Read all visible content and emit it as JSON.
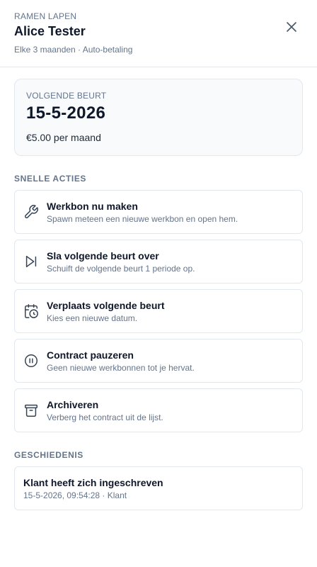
{
  "header": {
    "service": "RAMEN LAPEN",
    "customer": "Alice Tester",
    "subtitle": "Elke 3 maanden · Auto-betaling",
    "close_icon": "close-icon"
  },
  "next_service": {
    "label": "VOLGENDE BEURT",
    "date": "15-5-2026",
    "price": "€5.00 per maand"
  },
  "quick_actions": {
    "title": "SNELLE ACTIES",
    "items": [
      {
        "icon": "wrench-icon",
        "title": "Werkbon nu maken",
        "desc": "Spawn meteen een nieuwe werkbon en open hem."
      },
      {
        "icon": "skip-forward-icon",
        "title": "Sla volgende beurt over",
        "desc": "Schuift de volgende beurt 1 periode op."
      },
      {
        "icon": "calendar-clock-icon",
        "title": "Verplaats volgende beurt",
        "desc": "Kies een nieuwe datum."
      },
      {
        "icon": "pause-circle-icon",
        "title": "Contract pauzeren",
        "desc": "Geen nieuwe werkbonnen tot je hervat."
      },
      {
        "icon": "archive-icon",
        "title": "Archiveren",
        "desc": "Verberg het contract uit de lijst."
      }
    ]
  },
  "history": {
    "title": "GESCHIEDENIS",
    "items": [
      {
        "title": "Klant heeft zich ingeschreven",
        "meta": "15-5-2026, 09:54:28 · Klant"
      }
    ]
  },
  "colors": {
    "text": "#0f172a",
    "muted": "#64748b",
    "border": "#e2e8f0",
    "card_bg": "#f8fafc"
  }
}
